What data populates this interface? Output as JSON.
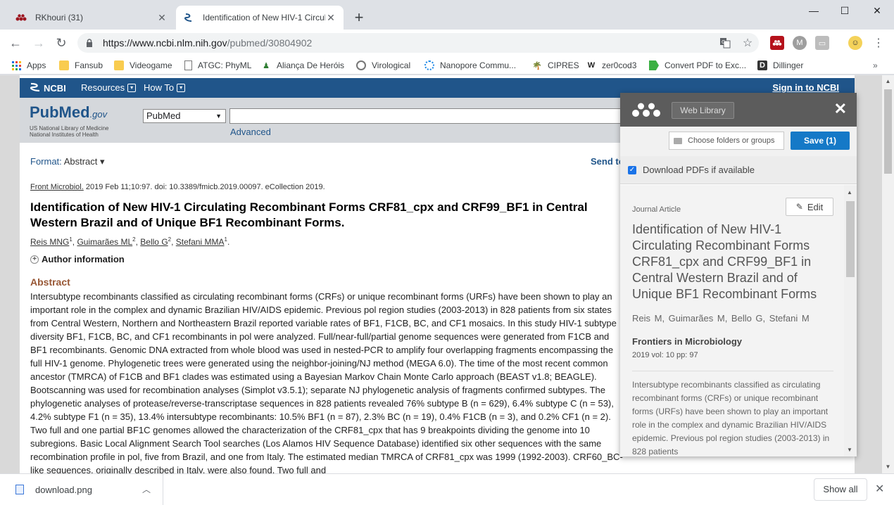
{
  "browser": {
    "tabs": [
      {
        "title": "RKhouri (31)",
        "active": false,
        "icon": "mendeley-icon"
      },
      {
        "title": "Identification of New HIV-1 Circula",
        "active": true,
        "icon": "ncbi-icon"
      }
    ],
    "new_tab_symbol": "+",
    "url_host": "https://www.ncbi.nlm.nih.gov",
    "url_path": "/pubmed/30804902",
    "bookmarks": [
      {
        "label": "Apps",
        "icon": "apps-grid-icon"
      },
      {
        "label": "Fansub",
        "icon": "folder-icon"
      },
      {
        "label": "Videogame",
        "icon": "folder-icon"
      },
      {
        "label": "ATGC: PhyML",
        "icon": "page-icon"
      },
      {
        "label": "Aliança De Heróis",
        "icon": "hero-icon"
      },
      {
        "label": "Virological",
        "icon": "virological-icon"
      },
      {
        "label": "Nanopore Commu...",
        "icon": "nanopore-icon"
      },
      {
        "label": "CIPRES",
        "icon": "cipres-icon"
      },
      {
        "label": "zer0cod3",
        "icon": "w-icon"
      },
      {
        "label": "Convert PDF to Exc...",
        "icon": "pdf-convert-icon"
      },
      {
        "label": "Dillinger",
        "icon": "d-icon"
      }
    ]
  },
  "ncbi": {
    "brand": "NCBI",
    "resources": "Resources",
    "howto": "How To",
    "signin": "Sign in to NCBI",
    "logo_main": "PubMed",
    "logo_gov": ".gov",
    "sub1": "US National Library of Medicine",
    "sub2": "National Institutes of Health",
    "db_value": "PubMed",
    "advanced": "Advanced"
  },
  "article": {
    "format_label": "Format",
    "format_value": "Abstract",
    "send_to": "Send to",
    "journal": "Front Microbiol.",
    "citation_rest": " 2019 Feb 11;10:97. doi: 10.3389/fmicb.2019.00097. eCollection 2019.",
    "title": "Identification of New HIV-1 Circulating Recombinant Forms CRF81_cpx and CRF99_BF1 in Central Western Brazil and of Unique BF1 Recombinant Forms.",
    "authors": [
      {
        "name": "Reis MNG",
        "sup": "1"
      },
      {
        "name": "Guimarães ML",
        "sup": "2"
      },
      {
        "name": "Bello G",
        "sup": "2"
      },
      {
        "name": "Stefani MMA",
        "sup": "1"
      }
    ],
    "author_info": "Author information",
    "abstract_heading": "Abstract",
    "abstract": "Intersubtype recombinants classified as circulating recombinant forms (CRFs) or unique recombinant forms (URFs) have been shown to play an important role in the complex and dynamic Brazilian HIV/AIDS epidemic. Previous pol region studies (2003-2013) in 828 patients from six states from Central Western, Northern and Northeastern Brazil reported variable rates of BF1, F1CB, BC, and CF1 mosaics. In this study HIV-1 subtype diversity BF1, F1CB, BC, and CF1 recombinants in pol were analyzed. Full/near-full/partial genome sequences were generated from F1CB and BF1 recombinants. Genomic DNA extracted from whole blood was used in nested-PCR to amplify four overlapping fragments encompassing the full HIV-1 genome. Phylogenetic trees were generated using the neighbor-joining/NJ method (MEGA 6.0). The time of the most recent common ancestor (TMRCA) of F1CB and BF1 clades was estimated using a Bayesian Markov Chain Monte Carlo approach (BEAST v1.8; BEAGLE). Bootscanning was used for recombination analyses (Simplot v3.5.1); separate NJ phylogenetic analysis of fragments confirmed subtypes. The phylogenetic analyses of protease/reverse-transcriptase sequences in 828 patients revealed 76% subtype B (n = 629), 6.4% subtype C (n = 53), 4.2% subtype F1 (n = 35), 13.4% intersubtype recombinants: 10.5% BF1 (n = 87), 2.3% BC (n = 19), 0.4% F1CB (n = 3), and 0.2% CF1 (n = 2). Two full and one partial BF1C genomes allowed the characterization of the CRF81_cpx that has 9 breakpoints dividing the genome into 10 subregions. Basic Local Alignment Search Tool searches (Los Alamos HIV Sequence Database) identified six other sequences with the same recombination profile in pol, five from Brazil, and one from Italy. The estimated median TMRCA of CRF81_cpx was 1999 (1992-2003). CRF60_BC-like sequences, originally described in Italy, were also found. Two full and"
  },
  "mendeley": {
    "web_library": "Web Library",
    "choose_placeholder": "Choose folders or groups",
    "save": "Save (1)",
    "download_pdfs": "Download PDFs if available",
    "type": "Journal Article",
    "edit": "Edit",
    "title": "Identification of New HIV-1 Circulating Recombinant Forms CRF81_cpx and CRF99_BF1 in Central Western Brazil and of Unique BF1 Recombinant Forms",
    "authors": "Reis M,  Guimarães M,  Bello G,  Stefani M",
    "journal": "Frontiers in Microbiology",
    "meta": "2019 vol: 10 pp: 97",
    "abstract": "Intersubtype recombinants classified as circulating recombinant forms (CRFs) or unique recombinant forms (URFs) have been shown to play an important role in the complex and dynamic Brazilian HIV/AIDS epidemic. Previous pol region studies (2003-2013) in 828 patients"
  },
  "downloads": {
    "file": "download.png",
    "show_all": "Show all"
  }
}
